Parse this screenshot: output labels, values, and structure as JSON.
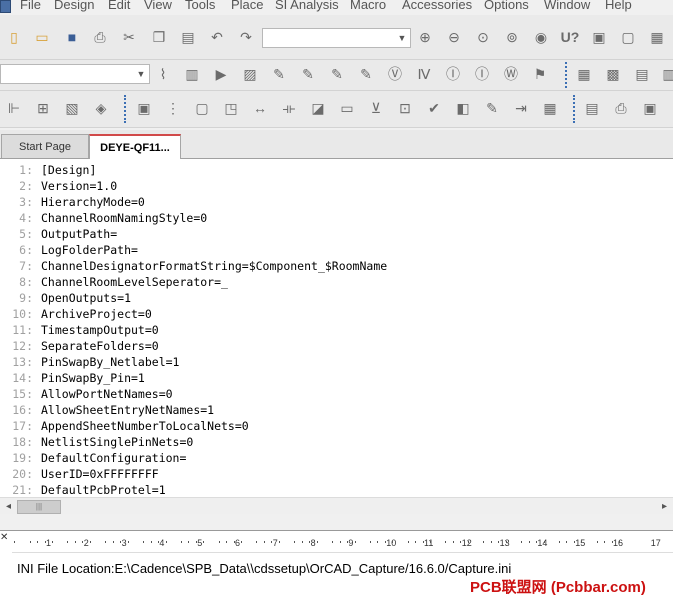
{
  "menu": [
    "File",
    "Design",
    "Edit",
    "View",
    "Tools",
    "Place",
    "SI Analysis",
    "Macro",
    "Accessories",
    "Options",
    "Window",
    "Help"
  ],
  "tabs": [
    {
      "label": "Start Page",
      "active": false
    },
    {
      "label": "DEYE-QF11...",
      "active": true
    }
  ],
  "editor_lines": [
    {
      "n": "1:",
      "t": "[Design]"
    },
    {
      "n": "2:",
      "t": "Version=1.0"
    },
    {
      "n": "3:",
      "t": "HierarchyMode=0"
    },
    {
      "n": "4:",
      "t": "ChannelRoomNamingStyle=0"
    },
    {
      "n": "5:",
      "t": "OutputPath="
    },
    {
      "n": "6:",
      "t": "LogFolderPath="
    },
    {
      "n": "7:",
      "t": "ChannelDesignatorFormatString=$Component_$RoomName"
    },
    {
      "n": "8:",
      "t": "ChannelRoomLevelSeperator=_"
    },
    {
      "n": "9:",
      "t": "OpenOutputs=1"
    },
    {
      "n": "10:",
      "t": "ArchiveProject=0"
    },
    {
      "n": "11:",
      "t": "TimestampOutput=0"
    },
    {
      "n": "12:",
      "t": "SeparateFolders=0"
    },
    {
      "n": "13:",
      "t": "PinSwapBy_Netlabel=1"
    },
    {
      "n": "14:",
      "t": "PinSwapBy_Pin=1"
    },
    {
      "n": "15:",
      "t": "AllowPortNetNames=0"
    },
    {
      "n": "16:",
      "t": "AllowSheetEntryNetNames=1"
    },
    {
      "n": "17:",
      "t": "AppendSheetNumberToLocalNets=0"
    },
    {
      "n": "18:",
      "t": "NetlistSinglePinNets=0"
    },
    {
      "n": "19:",
      "t": "DefaultConfiguration="
    },
    {
      "n": "20:",
      "t": "UserID=0xFFFFFFFF"
    },
    {
      "n": "21:",
      "t": "DefaultPcbProtel=1"
    }
  ],
  "ruler_numbers": [
    "1",
    "2",
    "3",
    "4",
    "5",
    "6",
    "7",
    "8",
    "9",
    "10",
    "11",
    "12",
    "13",
    "14",
    "15",
    "16",
    "17"
  ],
  "session_log": {
    "line1": "INI File Location:E:\\Cadence\\SPB_Data\\\\cdssetup\\OrCAD_Capture/16.6.0/Capture.ini"
  },
  "watermark": "PCB联盟网 (Pcbbar.com)",
  "toolbar1_icons": [
    "new-icon",
    "open-icon",
    "save-icon",
    "print-icon",
    "cut-icon",
    "copy-icon",
    "paste-icon",
    "undo-icon",
    "redo-icon"
  ],
  "toolbar1_icons_right": [
    "zoom-in-icon",
    "zoom-out-icon",
    "zoom-area-icon",
    "zoom-all-icon",
    "view-icon",
    "u7-icon",
    "annotate-icon",
    "netlist-icon",
    "bom-icon"
  ],
  "toolbar2_icons": [
    "waveform-icon",
    "probe-icon",
    "run-icon",
    "sim-icon",
    "voltage-icon",
    "current-icon",
    "power-icon",
    "v-marker-icon",
    "i-marker-icon",
    "w-marker-icon",
    "diff-marker-icon"
  ],
  "toolbar3_icons": [
    "part-icon",
    "wire-icon",
    "bus-icon",
    "net-alias-icon",
    "gnd-icon",
    "port-icon",
    "offpage-icon",
    "hier-icon",
    "pin-icon",
    "text-icon"
  ]
}
